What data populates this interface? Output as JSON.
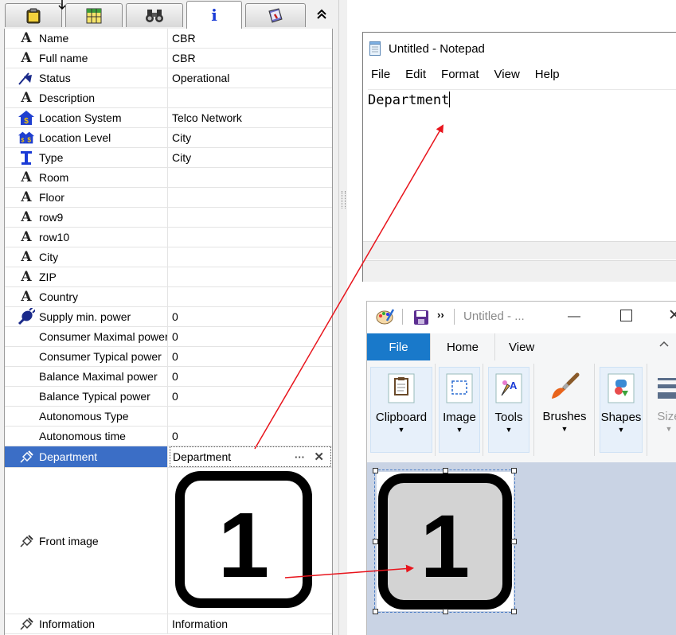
{
  "properties": {
    "tabs": [
      {
        "icon": "clipboard-icon",
        "label": ""
      },
      {
        "icon": "table-icon",
        "label": ""
      },
      {
        "icon": "binoculars-icon",
        "label": ""
      },
      {
        "icon": "info-icon",
        "label": "i"
      },
      {
        "icon": "book-icon",
        "label": ""
      }
    ],
    "collapse_label": "⌃⌃",
    "rows": [
      {
        "icon": "text-a-icon",
        "name": "Name",
        "value": "CBR"
      },
      {
        "icon": "text-a-icon",
        "name": "Full name",
        "value": "CBR"
      },
      {
        "icon": "status-icon",
        "name": "Status",
        "value": "Operational"
      },
      {
        "icon": "text-a-icon",
        "name": "Description",
        "value": ""
      },
      {
        "icon": "location-system-icon",
        "name": "Location System",
        "value": "Telco Network"
      },
      {
        "icon": "location-level-icon",
        "name": "Location Level",
        "value": "City"
      },
      {
        "icon": "type-icon",
        "name": "Type",
        "value": "City"
      },
      {
        "icon": "text-a-icon",
        "name": "Room",
        "value": ""
      },
      {
        "icon": "text-a-icon",
        "name": "Floor",
        "value": ""
      },
      {
        "icon": "text-a-icon",
        "name": "row9",
        "value": ""
      },
      {
        "icon": "text-a-icon",
        "name": "row10",
        "value": ""
      },
      {
        "icon": "text-a-icon",
        "name": "City",
        "value": ""
      },
      {
        "icon": "text-a-icon",
        "name": "ZIP",
        "value": ""
      },
      {
        "icon": "text-a-icon",
        "name": "Country",
        "value": ""
      },
      {
        "icon": "plug-icon",
        "name": "Supply min. power",
        "value": "0"
      },
      {
        "icon": "",
        "name": "Consumer Maximal power",
        "value": "0"
      },
      {
        "icon": "",
        "name": "Consumer Typical power",
        "value": "0"
      },
      {
        "icon": "",
        "name": "Balance Maximal power",
        "value": "0"
      },
      {
        "icon": "",
        "name": "Balance Typical power",
        "value": "0"
      },
      {
        "icon": "",
        "name": "Autonomous Type",
        "value": ""
      },
      {
        "icon": "",
        "name": "Autonomous time",
        "value": "0"
      }
    ],
    "department": {
      "icon": "pen-icon",
      "name": "Department",
      "value": "Department",
      "ellipsis": "···",
      "clear": "✕"
    },
    "front_image": {
      "icon": "pen-icon",
      "name": "Front image",
      "number": "1"
    },
    "information": {
      "icon": "pen-icon",
      "name": "Information",
      "value": "Information"
    }
  },
  "notepad": {
    "title": "Untitled - Notepad",
    "menu": [
      "File",
      "Edit",
      "Format",
      "View",
      "Help"
    ],
    "text": "Department"
  },
  "paint": {
    "title": "Untitled - ...",
    "quick_more": "››",
    "tabs": {
      "file": "File",
      "home": "Home",
      "view": "View"
    },
    "ribbon": [
      {
        "icon": "clipboard-icon",
        "label": "Clipboard"
      },
      {
        "icon": "image-select-icon",
        "label": "Image"
      },
      {
        "icon": "tools-icon",
        "label": "Tools"
      },
      {
        "icon": "brush-icon",
        "label": "Brushes"
      },
      {
        "icon": "shapes-icon",
        "label": "Shapes"
      },
      {
        "icon": "size-icon",
        "label": "Size"
      }
    ],
    "canvas_number": "1"
  },
  "colors": {
    "selection": "#3b6ec6",
    "arrow": "#e8141c",
    "paint_file_tab": "#1979ca",
    "paint_canvas_bg": "#c9d3e4"
  }
}
